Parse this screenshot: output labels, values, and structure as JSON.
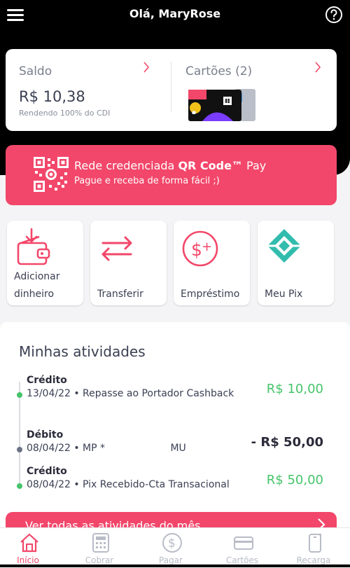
{
  "header": {
    "title": "Olá, MaryRose"
  },
  "balance": {
    "label": "Saldo",
    "amount": "R$ 10,38",
    "note": "Rendendo 100% do CDI"
  },
  "cards": {
    "label": "Cartões (2)"
  },
  "qr_banner": {
    "title_prefix": "Rede credenciada ",
    "title_bold": "QR Code™",
    "title_suffix": " Pay",
    "subtitle": "Pague e receba de forma fácil ;)"
  },
  "actions": [
    {
      "line1": "Adicionar",
      "line2": "dinheiro",
      "icon": "wallet-add-icon"
    },
    {
      "line1": "",
      "line2": "Transferir",
      "icon": "transfer-arrows-icon"
    },
    {
      "line1": "",
      "line2": "Empréstimo",
      "icon": "loan-dollar-icon"
    },
    {
      "line1": "",
      "line2": "Meu Pix",
      "icon": "pix-icon"
    }
  ],
  "activities": {
    "title": "Minhas atividades",
    "items": [
      {
        "type": "Crédito",
        "desc": "13/04/22 • Repasse ao Portador Cashback",
        "amount": "R$ 10,00",
        "kind": "credit",
        "dot_color": "#45c46a"
      },
      {
        "type": "Débito",
        "desc": "08/04/22 • MP *                     MU",
        "amount": "- R$ 50,00",
        "kind": "debit",
        "dot_color": "#6b7385"
      },
      {
        "type": "Crédito",
        "desc": "08/04/22 • Pix Recebido-Cta Transacional",
        "amount": "R$ 50,00",
        "kind": "credit",
        "dot_color": "#45c46a"
      }
    ],
    "more_label": "Ver todas as atividades do mês"
  },
  "nav": [
    {
      "label": "Início",
      "icon": "home-icon",
      "active": true
    },
    {
      "label": "Cobrar",
      "icon": "calculator-icon",
      "active": false
    },
    {
      "label": "Pagar",
      "icon": "dollar-circle-icon",
      "active": false
    },
    {
      "label": "Cartões",
      "icon": "card-icon",
      "active": false
    },
    {
      "label": "Recarga",
      "icon": "phone-recharge-icon",
      "active": false
    }
  ],
  "colors": {
    "accent": "#f2476a",
    "credit": "#45c46a",
    "header_bg": "#000000"
  }
}
